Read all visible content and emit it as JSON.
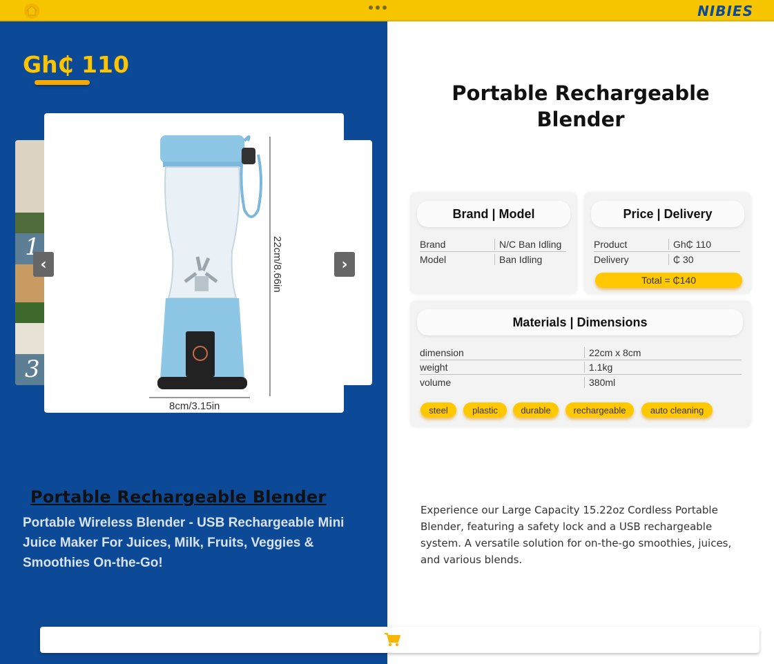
{
  "topbar": {
    "brand": "NIBIES",
    "logo_icon": "home-icon",
    "menu_icon": "more-dots-icon",
    "color": "#f7c500"
  },
  "left": {
    "price": "Gh₵ 110",
    "title": "Portable Rechargeable Blender",
    "subtitle": "Portable Wireless Blender - USB Rechargeable Mini Juice Maker For Juices, Milk, Fruits, Veggies & Smoothies On-the-Go!",
    "panel_color": "#0c4a97",
    "accent": "#ffc400",
    "carousel": {
      "prev_icon": "chevron-left-icon",
      "next_icon": "chevron-right-icon",
      "side_numbers": [
        "1",
        "3"
      ],
      "product_image": {
        "height_label": "22cm/8.66in",
        "width_label": "8cm/3.15in"
      }
    }
  },
  "right": {
    "title_line1": "Portable Rechargeable",
    "title_line2": "Blender",
    "brand_model": {
      "heading": "Brand | Model",
      "rows": [
        {
          "key": "Brand",
          "value": "N/C Ban Idling"
        },
        {
          "key": "Model",
          "value": "Ban Idling"
        }
      ]
    },
    "price_delivery": {
      "heading": "Price | Delivery",
      "rows": [
        {
          "key": "Product",
          "value": "Gh₵ 110"
        },
        {
          "key": "Delivery",
          "value": "₵ 30"
        }
      ],
      "total": "Total = ₵140"
    },
    "materials": {
      "heading": "Materials | Dimensions",
      "rows": [
        {
          "key": "dimension",
          "value": "22cm x 8cm"
        },
        {
          "key": "weight",
          "value": "1.1kg"
        },
        {
          "key": "volume",
          "value": "380ml"
        }
      ],
      "tags": [
        "steel",
        "plastic",
        "durable",
        "rechargeable",
        "auto cleaning"
      ]
    },
    "description": "Experience our Large Capacity 15.22oz Cordless Portable Blender, featuring a safety lock and a USB rechargeable system. A versatile solution for on-the-go smoothies, juices, and various blends."
  },
  "bottom": {
    "cart_icon": "cart-icon",
    "cart_color": "#f7b500"
  }
}
